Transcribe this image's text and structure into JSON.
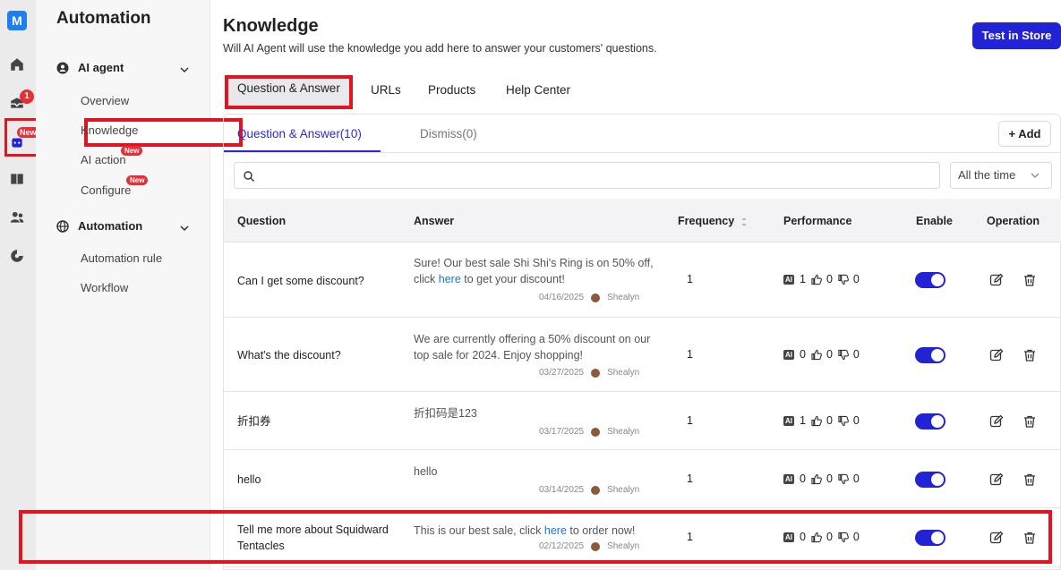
{
  "app": {
    "logo_letter": "M"
  },
  "rail": {
    "badge_count": "1",
    "new_tag": "New"
  },
  "sidebar": {
    "title": "Automation",
    "groups": [
      {
        "label": "AI agent",
        "items": [
          {
            "label": "Overview"
          },
          {
            "label": "Knowledge"
          },
          {
            "label": "AI action",
            "tag": "New"
          },
          {
            "label": "Configure",
            "tag": "New"
          }
        ]
      },
      {
        "label": "Automation",
        "items": [
          {
            "label": "Automation rule"
          },
          {
            "label": "Workflow"
          }
        ]
      }
    ]
  },
  "header": {
    "title": "Knowledge",
    "subtitle": "Will AI Agent will use the knowledge you add here to answer your customers' questions.",
    "test_button": "Test in Store"
  },
  "top_tabs": [
    "Question & Answer",
    "URLs",
    "Products",
    "Help Center"
  ],
  "sub_tabs": [
    "Question & Answer(10)",
    "Dismiss(0)"
  ],
  "add_button": "+ Add",
  "search": {
    "placeholder": ""
  },
  "time_filter": "All the time",
  "table": {
    "columns": [
      "Question",
      "Answer",
      "Frequency",
      "Performance",
      "Enable",
      "Operation"
    ],
    "rows": [
      {
        "question": "Can I get some discount?",
        "answer_pre": "Sure! Our best sale Shi Shi's Ring is on 50% off, click ",
        "answer_link": "here",
        "answer_post": " to get your discount!",
        "date": "04/16/2025",
        "author": "Shealyn",
        "frequency": "1",
        "ai": "1",
        "up": "0",
        "down": "0",
        "enabled": true
      },
      {
        "question": "What's the discount?",
        "answer_pre": "We are currently offering a 50% discount on our top sale for 2024. Enjoy shopping!",
        "answer_link": "",
        "answer_post": "",
        "date": "03/27/2025",
        "author": "Shealyn",
        "frequency": "1",
        "ai": "0",
        "up": "0",
        "down": "0",
        "enabled": true
      },
      {
        "question": "折扣券",
        "answer_pre": "折扣码是123",
        "answer_link": "",
        "answer_post": "",
        "date": "03/17/2025",
        "author": "Shealyn",
        "frequency": "1",
        "ai": "1",
        "up": "0",
        "down": "0",
        "enabled": true
      },
      {
        "question": "hello",
        "answer_pre": "hello",
        "answer_link": "",
        "answer_post": "",
        "date": "03/14/2025",
        "author": "Shealyn",
        "frequency": "1",
        "ai": "0",
        "up": "0",
        "down": "0",
        "enabled": true
      },
      {
        "question": "Tell me more about Squidward Tentacles",
        "answer_pre": "This is our best sale, click ",
        "answer_link": "here",
        "answer_post": " to order now!",
        "date": "02/12/2025",
        "author": "Shealyn",
        "frequency": "1",
        "ai": "0",
        "up": "0",
        "down": "0",
        "enabled": true
      }
    ]
  },
  "colors": {
    "accent": "#2323d6",
    "highlight": "#e5121f",
    "badge": "#e5303a",
    "link": "#1a73e8"
  },
  "ai_badge": "AI"
}
